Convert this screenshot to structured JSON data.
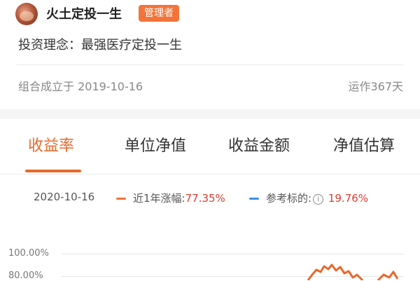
{
  "header": {
    "username": "火土定投一生",
    "badge": "管理者",
    "philosophy": "投资理念：最强医疗定投一生"
  },
  "meta": {
    "founded": "组合成立于 2019-10-16",
    "running": "运作367天"
  },
  "tabs": [
    {
      "label": "收益率",
      "active": true
    },
    {
      "label": "单位净值",
      "active": false
    },
    {
      "label": "收益金额",
      "active": false
    },
    {
      "label": "净值估算",
      "active": false
    }
  ],
  "summary": {
    "date": "2020-10-16",
    "primary_label": "近1年涨幅:",
    "primary_value": "77.35%",
    "benchmark_label": "参考标的:",
    "benchmark_value": "19.76%",
    "primary_color": "#f2743a",
    "benchmark_color": "#3d8fe0",
    "info_icon": "info-icon"
  },
  "chart_data": {
    "type": "line",
    "yticks": [
      "100.00%",
      "80.00%"
    ],
    "series": []
  },
  "colors": {
    "accent": "#e9692c",
    "badge": "#f2743a",
    "value_red": "#e03b2e"
  }
}
